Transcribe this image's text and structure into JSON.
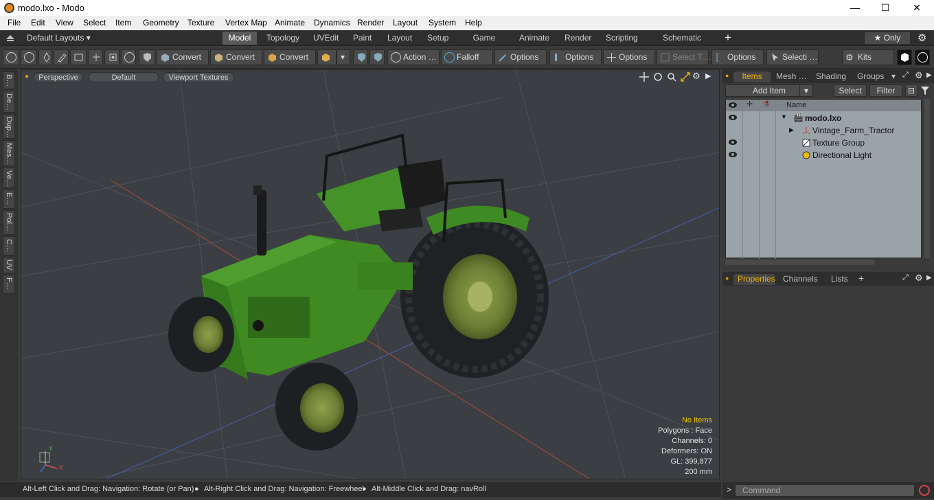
{
  "window": {
    "title": "modo.lxo - Modo",
    "minimize": "—",
    "maximize": "☐",
    "close": "✕"
  },
  "menu": [
    "File",
    "Edit",
    "View",
    "Select",
    "Item",
    "Geometry",
    "Texture",
    "Vertex Map",
    "Animate",
    "Dynamics",
    "Render",
    "Layout",
    "System",
    "Help"
  ],
  "layoutbar": {
    "layouts_label": "Default Layouts ▾",
    "tabs": [
      "Model",
      "Topology",
      "UVEdit",
      "Paint",
      "Layout",
      "Setup",
      "Game Tools",
      "Animate",
      "Render",
      "Scripting",
      "Schematic Fusion"
    ],
    "active_tab": "Model",
    "add_label": "+",
    "only_label": "★  Only",
    "settings_label": "⚙"
  },
  "toolbar": {
    "convert1": "Convert",
    "convert2": "Convert",
    "convert3": "Convert",
    "action": "Action  …",
    "falloff": "Falloff",
    "options1": "Options",
    "options2": "Options",
    "options3": "Options",
    "select_t": "Select T…",
    "options4": "Options",
    "selecti": "Selecti …",
    "kits": "Kits"
  },
  "lefttabs": [
    "B…",
    "De…",
    "Dup…",
    "Mes…",
    "Ve…",
    "E…",
    "Pol…",
    "C…",
    "UV",
    "F…"
  ],
  "viewport": {
    "tab_perspective": "Perspective",
    "tab_default": "Default",
    "tab_textures": "Viewport Textures",
    "info": {
      "no_items": "No Items",
      "polygons": "Polygons : Face",
      "channels": "Channels: 0",
      "deformers": "Deformers: ON",
      "gl": "GL: 399,877",
      "scale": "200 mm"
    },
    "axis_x": "X",
    "axis_y": "Y"
  },
  "statusbar": {
    "hint1": "Alt-Left Click and Drag: Navigation: Rotate (or Pan)",
    "hint2": "Alt-Right Click and Drag: Navigation: Freewheel",
    "hint3": "Alt-Middle Click and Drag: navRoll",
    "bullet": "●"
  },
  "items_panel": {
    "tabs": [
      "Items",
      "Mesh …",
      "Shading",
      "Groups"
    ],
    "add_item": "Add Item",
    "select": "Select",
    "filter": "Filter",
    "col_name": "Name",
    "rows": [
      {
        "name": "modo.lxo",
        "visible": true
      },
      {
        "name": "Vintage_Farm_Tractor",
        "visible": false
      },
      {
        "name": "Texture Group",
        "visible": true
      },
      {
        "name": "Directional Light",
        "visible": true
      }
    ]
  },
  "props_panel": {
    "tabs": [
      "Properties",
      "Channels",
      "Lists"
    ],
    "add": "+"
  },
  "command": {
    "prompt": ">",
    "placeholder": "Command"
  },
  "colors": {
    "accent": "#f0b000",
    "viewport_bg": "#3b3f43",
    "tractor_green": "#3f8a22"
  }
}
